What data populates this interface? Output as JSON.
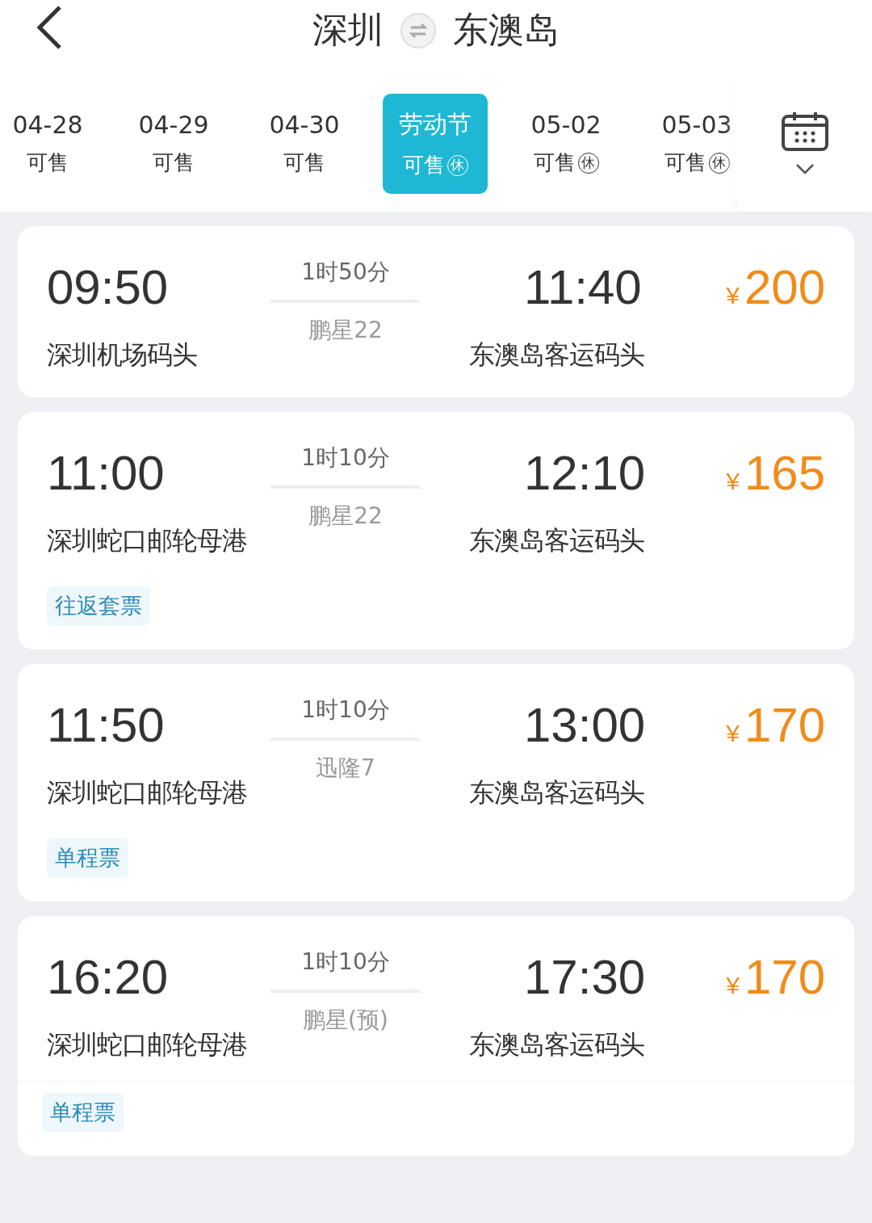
{
  "header": {
    "from": "深圳",
    "to": "东澳岛"
  },
  "dates": [
    {
      "label": "04-28",
      "status": "可售",
      "selected": false
    },
    {
      "label": "04-29",
      "status": "可售",
      "selected": false
    },
    {
      "label": "04-30",
      "status": "可售",
      "selected": false
    },
    {
      "label": "劳动节",
      "status": "可售",
      "mark": "休",
      "selected": true
    },
    {
      "label": "05-02",
      "status": "可售",
      "mark": "休",
      "selected": false
    },
    {
      "label": "05-03",
      "status": "可售",
      "mark": "休",
      "selected": false
    }
  ],
  "trips": [
    {
      "depart": "09:50",
      "duration": "1时50分",
      "vessel": "鹏星22",
      "arrive": "11:40",
      "currency": "¥",
      "price": "200",
      "from_port": "深圳机场码头",
      "to_port": "东澳岛客运码头",
      "separated": false
    },
    {
      "depart": "11:00",
      "duration": "1时10分",
      "vessel": "鹏星22",
      "arrive": "12:10",
      "currency": "¥",
      "price": "165",
      "from_port": "深圳蛇口邮轮母港",
      "to_port": "东澳岛客运码头",
      "tag": "往返套票",
      "separated": false
    },
    {
      "depart": "11:50",
      "duration": "1时10分",
      "vessel": "迅隆7",
      "arrive": "13:00",
      "currency": "¥",
      "price": "170",
      "from_port": "深圳蛇口邮轮母港",
      "to_port": "东澳岛客运码头",
      "tag": "单程票",
      "separated": false
    },
    {
      "depart": "16:20",
      "duration": "1时10分",
      "vessel": "鹏星(预)",
      "arrive": "17:30",
      "currency": "¥",
      "price": "170",
      "from_port": "深圳蛇口邮轮母港",
      "to_port": "东澳岛客运码头",
      "tag": "单程票",
      "separated": true
    }
  ]
}
